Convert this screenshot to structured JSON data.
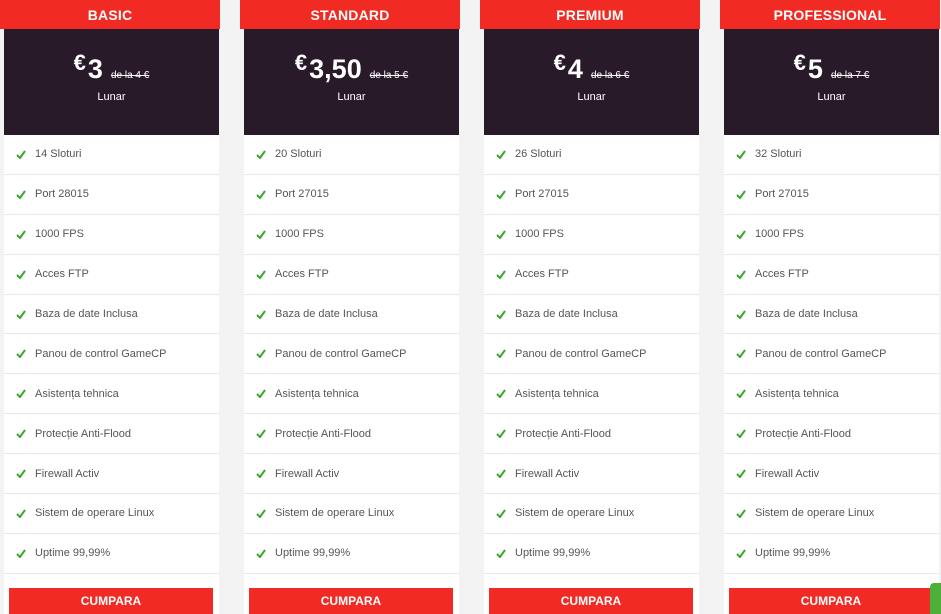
{
  "colors": {
    "accent": "#f22a24",
    "price_bg": "#281a28",
    "check": "#37a82e",
    "text": "#555555"
  },
  "plans": [
    {
      "name": "BASIC",
      "currency": "€",
      "price": "3",
      "old_price": "de la 4 €",
      "period": "Lunar",
      "features": [
        "14 Sloturi",
        "Port 28015",
        "1000 FPS",
        "Acces FTP",
        "Baza de date Inclusa",
        "Panou de control GameCP",
        "Asistența tehnica",
        "Protecție Anti-Flood",
        "Firewall Activ",
        "Sistem de operare Linux",
        "Uptime 99,99%"
      ],
      "button": "CUMPARA"
    },
    {
      "name": "STANDARD",
      "currency": "€",
      "price": "3,50",
      "old_price": "de la 5 €",
      "period": "Lunar",
      "features": [
        "20 Sloturi",
        "Port 27015",
        "1000 FPS",
        "Acces FTP",
        "Baza de date Inclusa",
        "Panou de control GameCP",
        "Asistența tehnica",
        "Protecție Anti-Flood",
        "Firewall Activ",
        "Sistem de operare Linux",
        "Uptime 99,99%"
      ],
      "button": "CUMPARA"
    },
    {
      "name": "PREMIUM",
      "currency": "€",
      "price": "4",
      "old_price": "de la 6 €",
      "period": "Lunar",
      "features": [
        "26 Sloturi",
        "Port 27015",
        "1000 FPS",
        "Acces FTP",
        "Baza de date Inclusa",
        "Panou de control GameCP",
        "Asistența tehnica",
        "Protecție Anti-Flood",
        "Firewall Activ",
        "Sistem de operare Linux",
        "Uptime 99,99%"
      ],
      "button": "CUMPARA"
    },
    {
      "name": "PROFESSIONAL",
      "currency": "€",
      "price": "5",
      "old_price": "de la 7 €",
      "period": "Lunar",
      "features": [
        "32 Sloturi",
        "Port 27015",
        "1000 FPS",
        "Acces FTP",
        "Baza de date Inclusa",
        "Panou de control GameCP",
        "Asistența tehnica",
        "Protecție Anti-Flood",
        "Firewall Activ",
        "Sistem de operare Linux",
        "Uptime 99,99%"
      ],
      "button": "CUMPARA"
    }
  ]
}
